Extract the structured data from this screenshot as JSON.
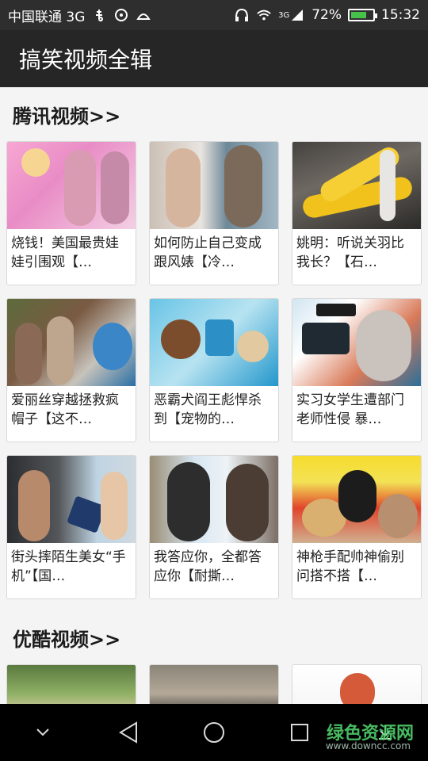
{
  "status_bar": {
    "carrier": "中国联通 3G",
    "network": "3G",
    "battery_percent": "72%",
    "battery_level": 0.72,
    "time": "15:32",
    "icons": [
      "usb-icon",
      "debug-icon",
      "android-icon",
      "headset-icon",
      "wifi-icon",
      "signal-icon",
      "battery-icon"
    ],
    "battery_color": "#46c24b"
  },
  "app_bar": {
    "title": "搞笑视频全辑"
  },
  "sections": [
    {
      "title": "腾讯视频>>",
      "videos": [
        {
          "caption": "烧钱！美国最贵娃娃引围观【…"
        },
        {
          "caption": "如何防止自己变成跟风婊【冷…"
        },
        {
          "caption": "姚明：听说关羽比我长？【石…"
        },
        {
          "caption": "爱丽丝穿越拯救疯帽子【这不…"
        },
        {
          "caption": "恶霸犬阎王彪悍杀到【宠物的…"
        },
        {
          "caption": "实习女学生遭部门老师性侵 暴…"
        },
        {
          "caption": "街头摔陌生美女“手机”【国…"
        },
        {
          "caption": "我答应你，全都答应你【耐撕…"
        },
        {
          "caption": "神枪手配帅神偷别问搭不搭【…"
        }
      ]
    },
    {
      "title": "优酷视频>>"
    }
  ],
  "nav_bar": {
    "icons": [
      "collapse-icon",
      "back-icon",
      "home-icon",
      "recents-icon",
      "download-icon"
    ]
  },
  "watermark": {
    "text": "绿色资源网",
    "url_text": "www.downcc.com"
  }
}
